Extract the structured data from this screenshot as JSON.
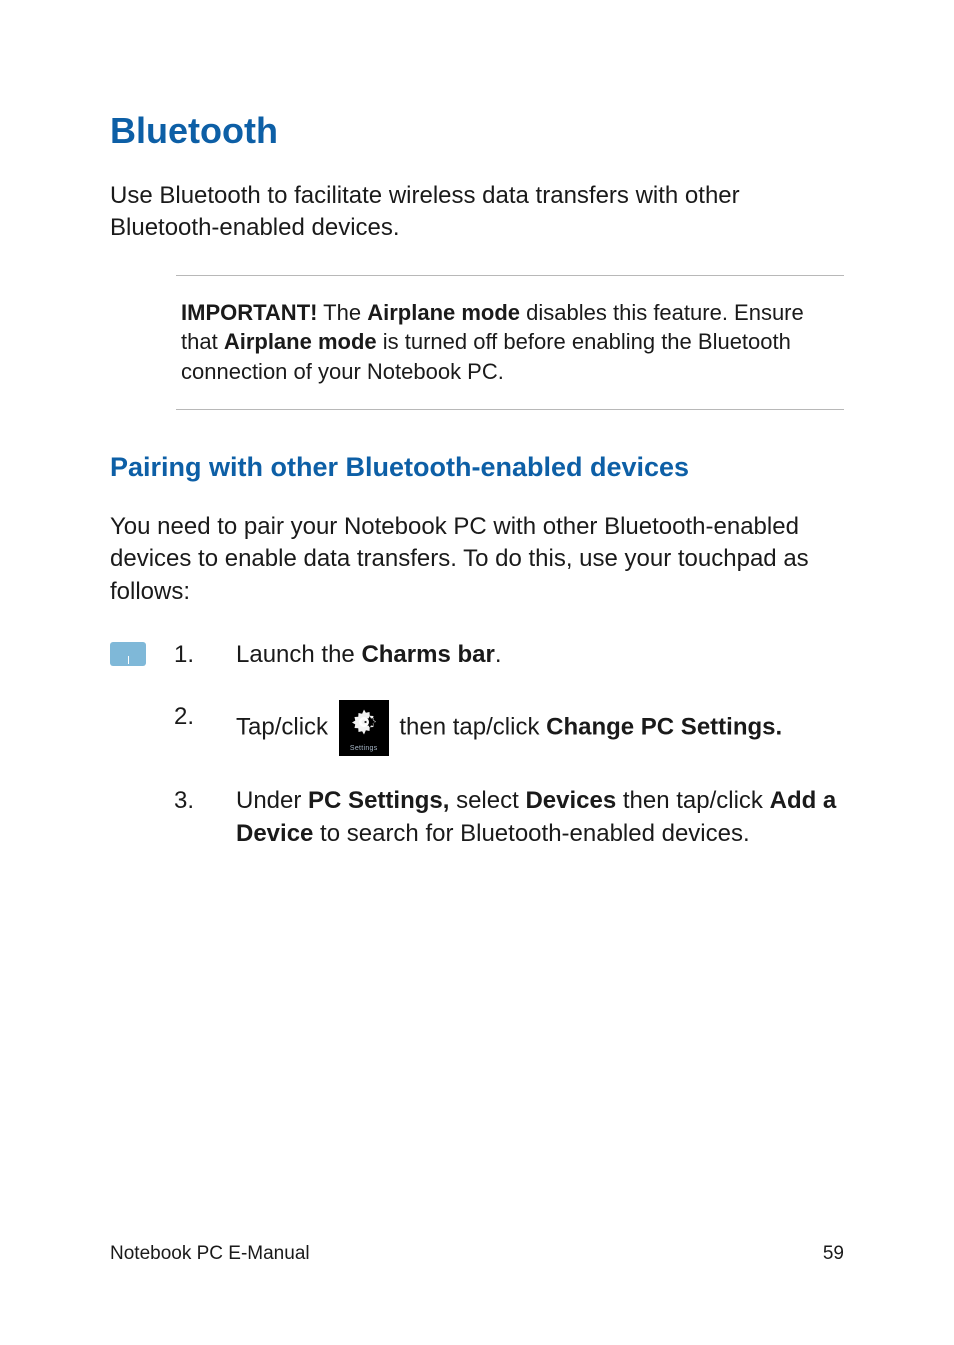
{
  "heading": "Bluetooth",
  "intro": "Use Bluetooth to facilitate wireless data transfers with other Bluetooth-enabled devices.",
  "callout": {
    "important_label": "IMPORTANT!",
    "seg1": " The ",
    "airplane_mode_1": "Airplane mode",
    "seg2": " disables this feature. Ensure that ",
    "airplane_mode_2": "Airplane mode",
    "seg3": " is turned off before enabling the Bluetooth connection of your Notebook PC."
  },
  "subheading": "Pairing with other Bluetooth-enabled devices",
  "pairing_intro": "You need to pair your Notebook PC with other Bluetooth-enabled devices to enable data transfers. To do this, use your touchpad as follows:",
  "steps": {
    "s1": {
      "num": "1.",
      "pre": "Launch the ",
      "bold": "Charms bar",
      "post": "."
    },
    "s2": {
      "num": "2.",
      "pre": "Tap/click ",
      "tile_label": "Settings",
      "mid": " then tap/click ",
      "bold": "Change PC Settings."
    },
    "s3": {
      "num": "3.",
      "pre": "Under ",
      "bold1": "PC Settings,",
      "mid1": " select ",
      "bold2": "Devices",
      "mid2": " then tap/click ",
      "bold3": "Add a Device",
      "post": " to search for Bluetooth-enabled devices."
    }
  },
  "footer": {
    "left": "Notebook PC E-Manual",
    "right": "59"
  }
}
